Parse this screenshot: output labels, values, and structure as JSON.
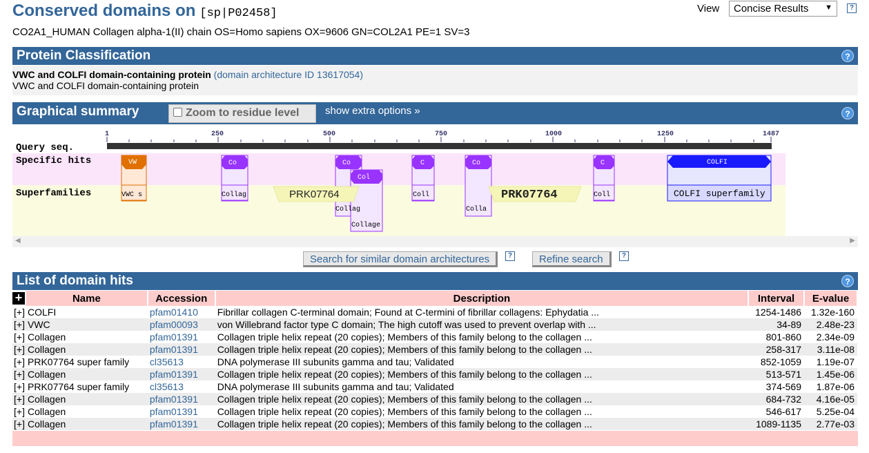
{
  "header": {
    "title": "Conserved domains on",
    "accession": "[sp|P02458]",
    "subtitle": "CO2A1_HUMAN Collagen alpha-1(II) chain OS=Homo sapiens OX=9606 GN=COL2A1 PE=1 SV=3",
    "view_label": "View",
    "view_value": "Concise Results",
    "help": "?"
  },
  "classification": {
    "section_title": "Protein Classification",
    "name": "VWC and COLFI domain-containing protein",
    "arch_link": "(domain architecture ID 13617054)",
    "description": "VWC and COLFI domain-containing protein"
  },
  "graphical": {
    "section_title": "Graphical summary",
    "zoom_label": "Zoom to residue level",
    "extra_options": "show extra options »",
    "row_labels": [
      "Query seq.",
      "Specific hits",
      "Superfamilies"
    ],
    "ticks": [
      "1",
      "250",
      "500",
      "750",
      "1000",
      "1250",
      "1487"
    ],
    "specific_hits": [
      {
        "label": "VW",
        "from": 34,
        "to": 89
      },
      {
        "label": "Co",
        "from": 258,
        "to": 317
      },
      {
        "label": "Co",
        "from": 513,
        "to": 571
      },
      {
        "label": "Col",
        "from": 546,
        "to": 617
      },
      {
        "label": "C",
        "from": 684,
        "to": 732
      },
      {
        "label": "Co",
        "from": 801,
        "to": 860
      },
      {
        "label": "C",
        "from": 1089,
        "to": 1135
      },
      {
        "label": "COLFI",
        "from": 1254,
        "to": 1486
      }
    ],
    "superfamilies": [
      {
        "label": "VWC s"
      },
      {
        "label": "Collag"
      },
      {
        "label": "PRK07764"
      },
      {
        "label": "Collag"
      },
      {
        "label": "Collage"
      },
      {
        "label": "Coll"
      },
      {
        "label": "Colla"
      },
      {
        "label": "PRK07764"
      },
      {
        "label": "Coll"
      },
      {
        "label": "COLFI superfamily"
      }
    ]
  },
  "actions": {
    "search_similar": "Search for similar domain architectures",
    "refine": "Refine search"
  },
  "hits": {
    "section_title": "List of domain hits",
    "expand_all": "+",
    "columns": [
      "Name",
      "Accession",
      "Description",
      "Interval",
      "E-value"
    ],
    "rows": [
      {
        "toggle": "[+]",
        "name": "COLFI",
        "accession": "pfam01410",
        "description": "Fibrillar collagen C-terminal domain; Found at C-termini of fibrillar collagens: Ephydatia ...",
        "interval": "1254-1486",
        "evalue": "1.32e-160"
      },
      {
        "toggle": "[+]",
        "name": "VWC",
        "accession": "pfam00093",
        "description": "von Willebrand factor type C domain; The high cutoff was used to prevent overlap with ...",
        "interval": "34-89",
        "evalue": "2.48e-23"
      },
      {
        "toggle": "[+]",
        "name": "Collagen",
        "accession": "pfam01391",
        "description": "Collagen triple helix repeat (20 copies); Members of this family belong to the collagen ...",
        "interval": "801-860",
        "evalue": "2.34e-09"
      },
      {
        "toggle": "[+]",
        "name": "Collagen",
        "accession": "pfam01391",
        "description": "Collagen triple helix repeat (20 copies); Members of this family belong to the collagen ...",
        "interval": "258-317",
        "evalue": "3.11e-08"
      },
      {
        "toggle": "[+]",
        "name": "PRK07764 super family",
        "accession": "cl35613",
        "description": "DNA polymerase III subunits gamma and tau; Validated",
        "interval": "852-1059",
        "evalue": "1.19e-07"
      },
      {
        "toggle": "[+]",
        "name": "Collagen",
        "accession": "pfam01391",
        "description": "Collagen triple helix repeat (20 copies); Members of this family belong to the collagen ...",
        "interval": "513-571",
        "evalue": "1.45e-06"
      },
      {
        "toggle": "[+]",
        "name": "PRK07764 super family",
        "accession": "cl35613",
        "description": "DNA polymerase III subunits gamma and tau; Validated",
        "interval": "374-569",
        "evalue": "1.87e-06"
      },
      {
        "toggle": "[+]",
        "name": "Collagen",
        "accession": "pfam01391",
        "description": "Collagen triple helix repeat (20 copies); Members of this family belong to the collagen ...",
        "interval": "684-732",
        "evalue": "4.16e-05"
      },
      {
        "toggle": "[+]",
        "name": "Collagen",
        "accession": "pfam01391",
        "description": "Collagen triple helix repeat (20 copies); Members of this family belong to the collagen ...",
        "interval": "546-617",
        "evalue": "5.25e-04"
      },
      {
        "toggle": "[+]",
        "name": "Collagen",
        "accession": "pfam01391",
        "description": "Collagen triple helix repeat (20 copies); Members of this family belong to the collagen ...",
        "interval": "1089-1135",
        "evalue": "2.77e-03"
      }
    ]
  },
  "colors": {
    "header_blue": "#336699",
    "specific_purple": "#9933ff",
    "specific_orange": "#e07000",
    "colfi_blue": "#1a1aff",
    "prk_yellow": "#ffffcc"
  }
}
